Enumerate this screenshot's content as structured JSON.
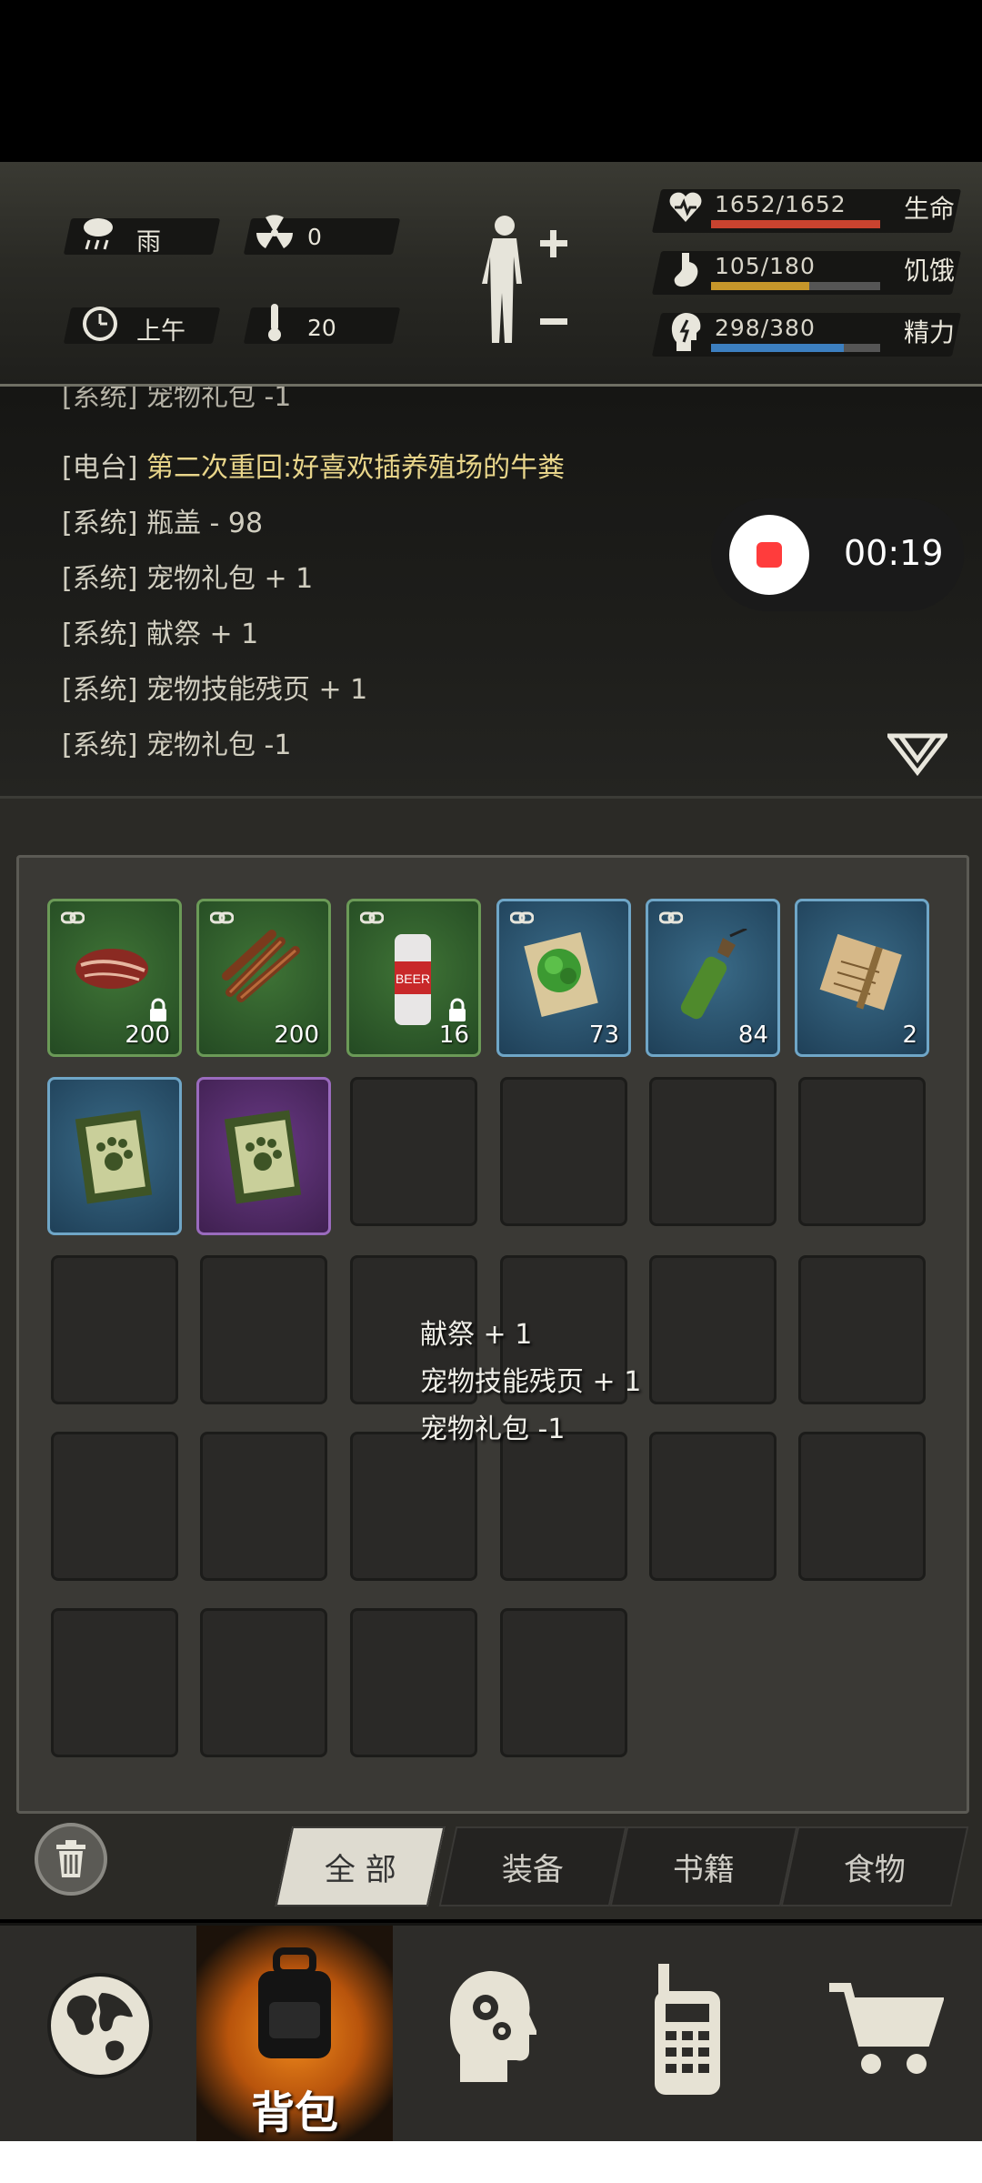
{
  "status": {
    "weather": "雨",
    "radiation": "0",
    "time_of_day": "上午",
    "temperature": "20",
    "health": {
      "value": "1652/1652",
      "label": "生命",
      "fill": 1.0,
      "color": "#c9432f"
    },
    "hunger": {
      "value": "105/180",
      "label": "饥饿",
      "fill": 0.583,
      "color": "#c6962a"
    },
    "energy": {
      "value": "298/380",
      "label": "精力",
      "fill": 0.784,
      "color": "#3c7fc0"
    }
  },
  "log": {
    "partial_top": "[系统] 宠物礼包 -1",
    "lines": [
      {
        "tag": "[电台]",
        "text": "第二次重回:好喜欢插养殖场的牛粪",
        "type": "radio"
      },
      {
        "tag": "[系统]",
        "text": "瓶盖 - 98",
        "type": "system"
      },
      {
        "tag": "[系统]",
        "text": "宠物礼包 + 1",
        "type": "system"
      },
      {
        "tag": "[系统]",
        "text": "献祭 + 1",
        "type": "system"
      },
      {
        "tag": "[系统]",
        "text": "宠物技能残页 + 1",
        "type": "system"
      },
      {
        "tag": "[系统]",
        "text": "宠物礼包 -1",
        "type": "system"
      }
    ]
  },
  "recording": {
    "time": "00:19"
  },
  "inventory": {
    "items": [
      {
        "name": "steak",
        "qty": "200",
        "rarity": "green",
        "linked": true,
        "locked": true
      },
      {
        "name": "jerky",
        "qty": "200",
        "rarity": "green",
        "linked": true,
        "locked": false
      },
      {
        "name": "beer-can",
        "qty": "16",
        "rarity": "green",
        "linked": true,
        "locked": true,
        "can_text": "BEER"
      },
      {
        "name": "herb-paper",
        "qty": "73",
        "rarity": "blue",
        "linked": true,
        "locked": false
      },
      {
        "name": "molotov",
        "qty": "84",
        "rarity": "blue",
        "linked": true,
        "locked": false
      },
      {
        "name": "map-scroll",
        "qty": "2",
        "rarity": "blue",
        "linked": false,
        "locked": false
      },
      {
        "name": "pet-book",
        "qty": "",
        "rarity": "blue",
        "linked": false,
        "locked": false
      },
      {
        "name": "pet-book",
        "qty": "",
        "rarity": "purple",
        "linked": false,
        "locked": false
      }
    ],
    "total_slots": 28
  },
  "float_messages": [
    "献祭 + 1",
    "宠物技能残页 + 1",
    "宠物礼包 -1"
  ],
  "tabs": [
    "全 部",
    "装备",
    "书籍",
    "食物"
  ],
  "nav": {
    "bag_label": "背包"
  }
}
